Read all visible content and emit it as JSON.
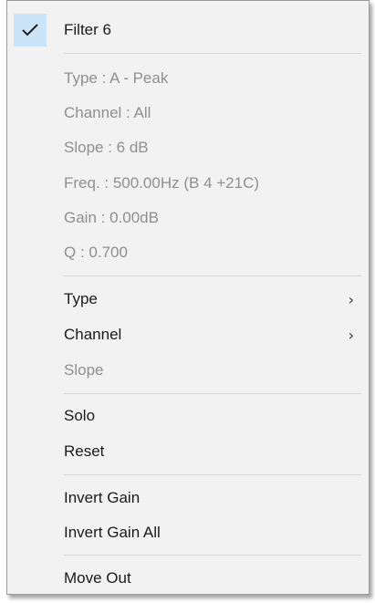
{
  "menu": {
    "header": {
      "label": "Filter 6",
      "checked": true
    },
    "info": [
      {
        "label": "Type : A - Peak"
      },
      {
        "label": "Channel : All"
      },
      {
        "label": "Slope :  6 dB"
      },
      {
        "label": "Freq. : 500.00Hz (B 4 +21C)"
      },
      {
        "label": "Gain : 0.00dB"
      },
      {
        "label": "Q : 0.700"
      }
    ],
    "type_label": "Type",
    "channel_label": "Channel",
    "slope_label": "Slope",
    "submenu_arrow": "›",
    "solo_label": "Solo",
    "reset_label": "Reset",
    "invert_gain_label": "Invert Gain",
    "invert_gain_all_label": "Invert Gain All",
    "move_out_label": "Move Out"
  },
  "colors": {
    "menu_background": "#f2f2f2",
    "check_highlight": "#cce4f7",
    "check_mark": "#1f1f1f",
    "disabled_text": "#8f8f8f"
  }
}
